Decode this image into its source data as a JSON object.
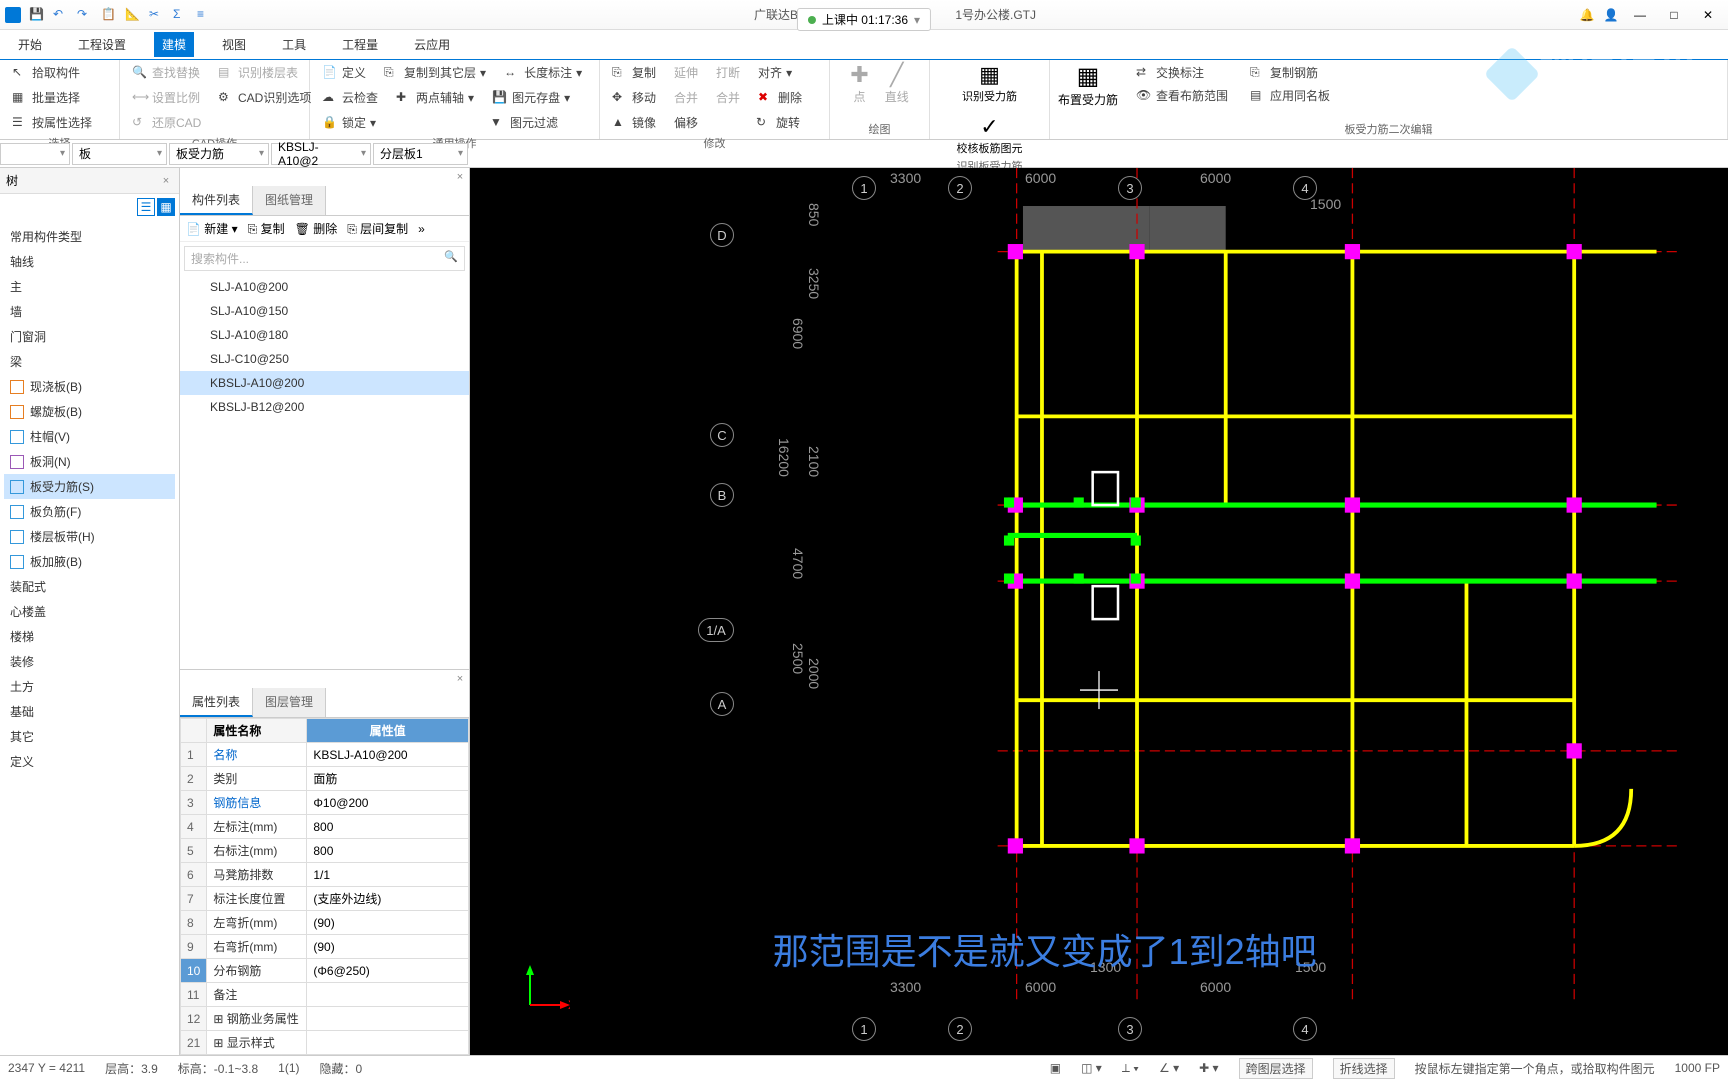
{
  "title_left_file": "广联达BIM土建",
  "title_right_file": "1号办公楼.GTJ",
  "session": {
    "label": "上课中 01:17:36"
  },
  "menu": {
    "start": "开始",
    "settings": "工程设置",
    "model": "建模",
    "view": "视图",
    "tools": "工具",
    "qty": "工程量",
    "cloud": "云应用"
  },
  "ribbon": {
    "g1": {
      "pick": "拾取构件",
      "batch": "批量选择",
      "prop": "按属性选择",
      "label": "选择"
    },
    "g2": {
      "find": "查找替换",
      "setscale": "设置比例",
      "restore": "还原CAD",
      "cadlayer": "识别楼层表",
      "cadopt": "CAD识别选项",
      "label": "CAD操作"
    },
    "g3": {
      "define": "定义",
      "cloud": "云检查",
      "lock": "锁定",
      "copyfloor": "复制到其它层",
      "twopoint": "两点辅轴",
      "length": "长度标注",
      "elestore": "图元存盘",
      "elefilter": "图元过滤",
      "label": "通用操作"
    },
    "g4": {
      "copy": "复制",
      "move": "移动",
      "mirror": "镜像",
      "extend": "延伸",
      "trim": "打断",
      "align": "对齐",
      "offset": "偏移",
      "merge": "合并",
      "del": "删除",
      "rotate": "旋转",
      "label": "修改"
    },
    "g5": {
      "point": "点",
      "line": "直线",
      "label": "绘图"
    },
    "g6": {
      "rec1": "识别受力筋",
      "rec2": "校核板筋图元",
      "label": "识别板受力筋"
    },
    "g7": {
      "layout": "布置受力筋",
      "swap": "交换标注",
      "viewrange": "查看布筋范围",
      "copyrebar": "复制钢筋",
      "sametpl": "应用同名板",
      "label": "板受力筋二次编辑"
    }
  },
  "selectors": {
    "s1": "",
    "s2": "板",
    "s3": "板受力筋",
    "s4": "KBSLJ-A10@2",
    "s5": "分层板1"
  },
  "nav_tree": {
    "title": "树",
    "common": "常用构件类型",
    "axis": "轴线",
    "wall": "",
    "door": "门窗洞",
    "beam": "",
    "items": [
      {
        "icon": "#e67e22",
        "label": "现浇板(B)"
      },
      {
        "icon": "#e67e22",
        "label": "螺旋板(B)"
      },
      {
        "icon": "#3498db",
        "label": "柱帽(V)"
      },
      {
        "icon": "#9b59b6",
        "label": "板洞(N)"
      },
      {
        "icon": "#3498db",
        "label": "板受力筋(S)",
        "selected": true
      },
      {
        "icon": "#3498db",
        "label": "板负筋(F)"
      },
      {
        "icon": "#3498db",
        "label": "楼层板带(H)"
      },
      {
        "icon": "#3498db",
        "label": "板加腋(B)"
      }
    ],
    "prefab": "装配式",
    "core": "心楼盖",
    "stair": "楼梯",
    "repair": "装修",
    "soil": "土方",
    "base": "基础",
    "other": "其它",
    "custom": "定义"
  },
  "comp_panel": {
    "tab1": "构件列表",
    "tab2": "图纸管理",
    "new": "新建",
    "copy": "复制",
    "del": "删除",
    "floorcopy": "层间复制",
    "search": "搜索构件...",
    "items": [
      "SLJ-A10@200",
      "SLJ-A10@150",
      "SLJ-A10@180",
      "SLJ-C10@250",
      "KBSLJ-A10@200",
      "KBSLJ-B12@200"
    ],
    "selected": 4
  },
  "prop_panel": {
    "tab1": "属性列表",
    "tab2": "图层管理",
    "h1": "属性名称",
    "h2": "属性值",
    "rows": [
      {
        "n": "1",
        "name": "名称",
        "val": "KBSLJ-A10@200",
        "blue": true
      },
      {
        "n": "2",
        "name": "类别",
        "val": "面筋"
      },
      {
        "n": "3",
        "name": "钢筋信息",
        "val": "Φ10@200",
        "blue": true
      },
      {
        "n": "4",
        "name": "左标注(mm)",
        "val": "800"
      },
      {
        "n": "5",
        "name": "右标注(mm)",
        "val": "800"
      },
      {
        "n": "6",
        "name": "马凳筋排数",
        "val": "1/1"
      },
      {
        "n": "7",
        "name": "标注长度位置",
        "val": "(支座外边线)"
      },
      {
        "n": "8",
        "name": "左弯折(mm)",
        "val": "(90)"
      },
      {
        "n": "9",
        "name": "右弯折(mm)",
        "val": "(90)"
      },
      {
        "n": "10",
        "name": "分布钢筋",
        "val": "(Φ6@250)",
        "sel": true
      },
      {
        "n": "11",
        "name": "备注",
        "val": ""
      },
      {
        "n": "12",
        "name": "钢筋业务属性",
        "val": "",
        "exp": true
      },
      {
        "n": "21",
        "name": "显示样式",
        "val": "",
        "exp": true
      }
    ]
  },
  "canvas": {
    "cols": [
      "1",
      "2",
      "3",
      "4"
    ],
    "rows": [
      "D",
      "C",
      "B",
      "1/A",
      "A"
    ],
    "top_dims": [
      "3300",
      "6000",
      "6000",
      "1500"
    ],
    "left_dims": [
      "850",
      "3250",
      "6900",
      "2100",
      "16200",
      "4700",
      "2500",
      "2000"
    ],
    "bot_dims": [
      "3300",
      "1300",
      "6000",
      "6000",
      "1500"
    ],
    "right_col": "80"
  },
  "subtitle": "那范围是不是就又变成了1到2轴吧",
  "status": {
    "coord": "2347 Y = 4211",
    "floor": "层高：3.9",
    "elev": "标高：-0.1~3.8",
    "count": "1(1)",
    "hidden": "隐藏：0",
    "span": "跨图层选择",
    "poly": "折线选择",
    "hint": "按鼠标左键指定第一个角点，或拾取构件图元",
    "fps": "1000 FP"
  }
}
